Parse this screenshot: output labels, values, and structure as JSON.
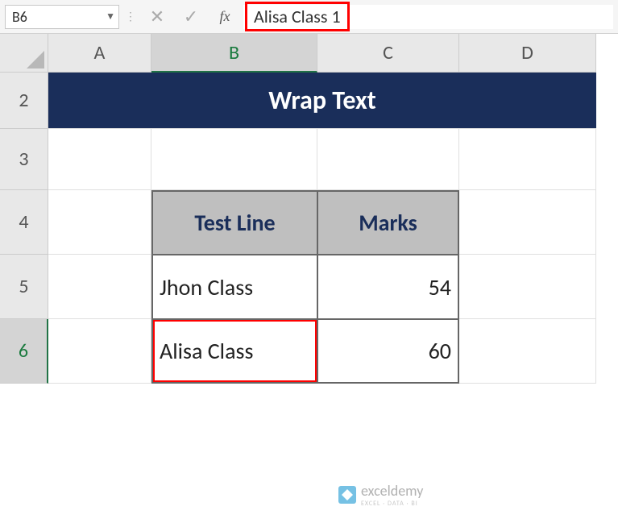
{
  "formula_bar": {
    "name_box": "B6",
    "formula_value": "Alisa Class 1"
  },
  "columns": {
    "A": "A",
    "B": "B",
    "C": "C",
    "D": "D"
  },
  "rows": {
    "r2": "2",
    "r3": "3",
    "r4": "4",
    "r5": "5",
    "r6": "6"
  },
  "title": "Wrap Text",
  "table": {
    "headers": {
      "test_line": "Test Line",
      "marks": "Marks"
    },
    "data": [
      {
        "name": "Jhon Class",
        "marks": "54"
      },
      {
        "name": "Alisa Class",
        "marks": "60"
      }
    ]
  },
  "watermark": {
    "brand": "exceldemy",
    "tagline": "EXCEL · DATA · BI"
  },
  "chart_data": {
    "type": "table",
    "title": "Wrap Text",
    "columns": [
      "Test Line",
      "Marks"
    ],
    "rows": [
      [
        "Jhon Class",
        54
      ],
      [
        "Alisa Class",
        60
      ]
    ]
  }
}
